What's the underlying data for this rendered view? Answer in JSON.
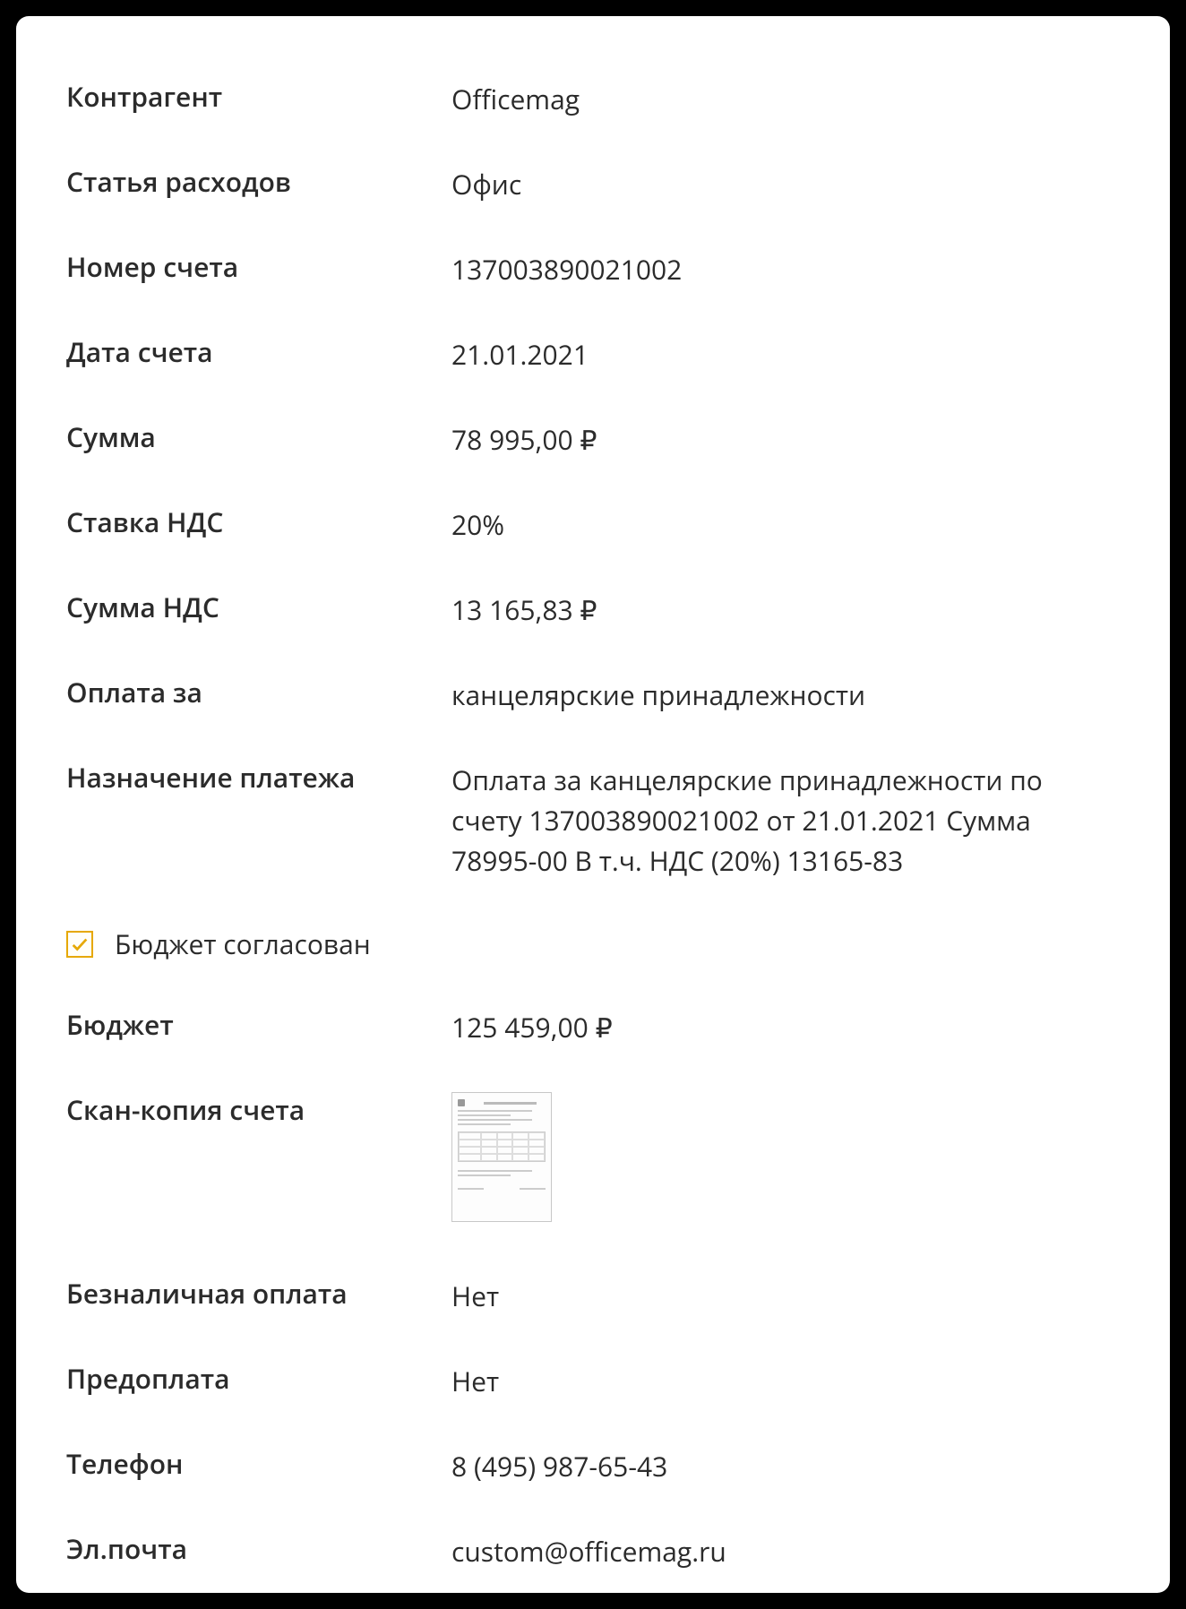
{
  "fields": {
    "contractor": {
      "label": "Контрагент",
      "value": "Officemag"
    },
    "expense_item": {
      "label": "Статья расходов",
      "value": "Офис"
    },
    "invoice_number": {
      "label": "Номер счета",
      "value": "137003890021002"
    },
    "invoice_date": {
      "label": "Дата счета",
      "value": "21.01.2021"
    },
    "amount": {
      "label": "Сумма",
      "value": "78 995,00 ₽"
    },
    "vat_rate": {
      "label": "Ставка НДС",
      "value": "20%"
    },
    "vat_amount": {
      "label": "Сумма НДС",
      "value": "13 165,83 ₽"
    },
    "payment_for": {
      "label": "Оплата за",
      "value": "канцелярские принадлежности"
    },
    "payment_purpose": {
      "label": "Назначение платежа",
      "value": "Оплата за канцелярские принадлежности по счету 137003890021002 от 21.01.2021 Сумма 78995-00 В т.ч. НДС (20%) 13165-83"
    },
    "budget": {
      "label": "Бюджет",
      "value": "125 459,00 ₽"
    },
    "scan": {
      "label": "Скан-копия счета"
    },
    "cashless": {
      "label": "Безналичная оплата",
      "value": "Нет"
    },
    "prepayment": {
      "label": "Предоплата",
      "value": "Нет"
    },
    "phone": {
      "label": "Телефон",
      "value": "8 (495) 987-65-43"
    },
    "email": {
      "label": "Эл.почта",
      "value": "custom@officemag.ru"
    }
  },
  "budget_approved": {
    "label": "Бюджет согласован",
    "checked": true
  }
}
